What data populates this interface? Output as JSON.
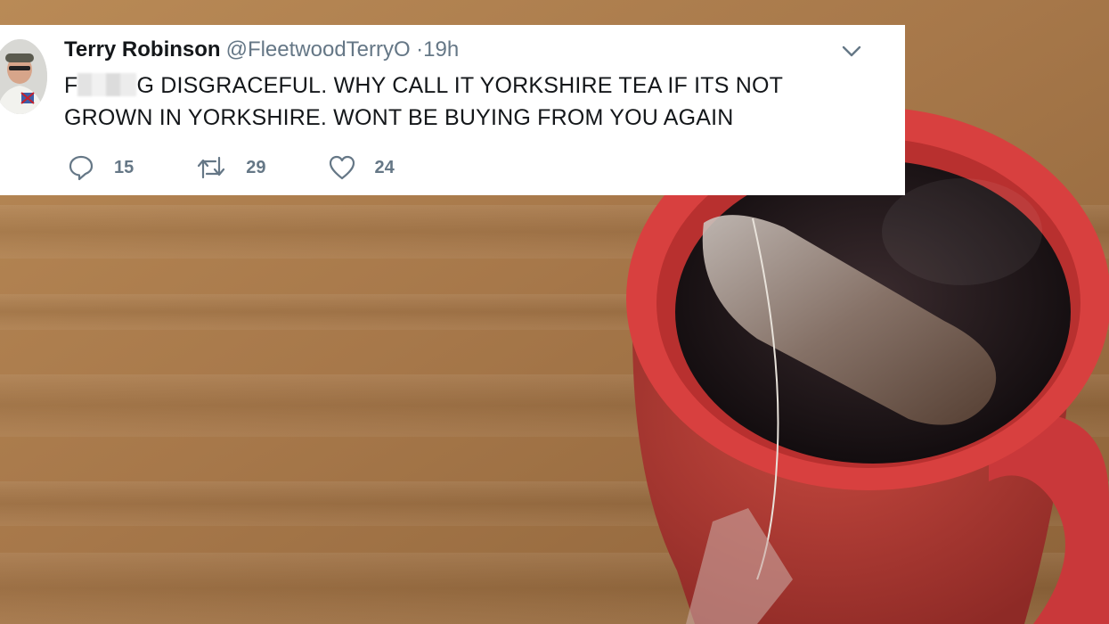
{
  "tweet": {
    "display_name": "Terry Robinson",
    "handle": "@FleetwoodTerryO",
    "separator": "·",
    "time": "19h",
    "text_prefix": "F",
    "text_rest": "G DISGRACEFUL. WHY CALL IT YORKSHIRE TEA IF ITS NOT GROWN IN YORKSHIRE. WONT BE BUYING FROM YOU AGAIN",
    "reply_count": "15",
    "retweet_count": "29",
    "like_count": "24",
    "icons": {
      "reply": "reply-icon",
      "retweet": "retweet-icon",
      "like": "heart-icon",
      "menu": "chevron-down-icon"
    }
  },
  "colors": {
    "text": "#14171a",
    "secondary": "#657786",
    "card": "#ffffff",
    "mug": "#d8403f",
    "table": "#a67a4a"
  }
}
